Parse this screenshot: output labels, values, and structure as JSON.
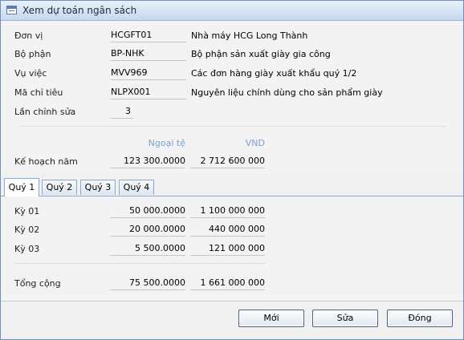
{
  "window": {
    "title": "Xem dự toán ngân sách"
  },
  "fields": [
    {
      "label": "Đơn vị",
      "code": "HCGFT01",
      "desc": "Nhà máy HCG Long Thành"
    },
    {
      "label": "Bộ phận",
      "code": "BP-NHK",
      "desc": "Bộ phận sản xuất giày gia công"
    },
    {
      "label": "Vụ việc",
      "code": "MVV969",
      "desc": "Các đơn hàng giày xuất khẩu quý 1/2"
    },
    {
      "label": "Mã chỉ tiêu",
      "code": "NLPX001",
      "desc": "Nguyên liệu chính dùng cho sản phẩm giày"
    },
    {
      "label": "Lần chỉnh sửa",
      "code": "3"
    }
  ],
  "columns": {
    "foreign": "Ngoại tệ",
    "vnd": "VND"
  },
  "annual_plan": {
    "label": "Kế hoạch năm",
    "foreign": "123 300.0000",
    "vnd": "2 712 600 000"
  },
  "tabs": [
    "Quý 1",
    "Quý 2",
    "Quý 3",
    "Quý 4"
  ],
  "periods": [
    {
      "label": "Kỳ 01",
      "foreign": "50 000.0000",
      "vnd": "1 100 000 000"
    },
    {
      "label": "Kỳ 02",
      "foreign": "20 000.0000",
      "vnd": "440 000 000"
    },
    {
      "label": "Kỳ 03",
      "foreign": "5 500.0000",
      "vnd": "121 000 000"
    }
  ],
  "total": {
    "label": "Tổng cộng",
    "foreign": "75 500.0000",
    "vnd": "1 661 000 000"
  },
  "buttons": {
    "new": "Mới",
    "edit": "Sửa",
    "close": "Đóng"
  }
}
